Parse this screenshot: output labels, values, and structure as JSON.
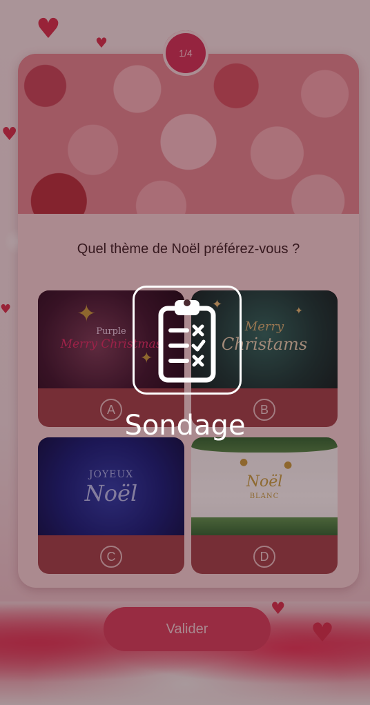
{
  "progress": {
    "label": "1/4",
    "current": 1,
    "total": 4
  },
  "question": "Quel thème de Noël préférez-vous ?",
  "options": [
    {
      "letter": "A",
      "title_top": "Purple",
      "title_main": "Merry Christmas"
    },
    {
      "letter": "B",
      "title_top": "Merry",
      "title_main": "Christams"
    },
    {
      "letter": "C",
      "title_top": "JOYEUX",
      "title_main": "Noël"
    },
    {
      "letter": "D",
      "title_top": "Noël",
      "title_main": "BLANC"
    }
  ],
  "validate_label": "Valider",
  "overlay": {
    "label": "Sondage",
    "icon": "clipboard-checklist-icon"
  },
  "colors": {
    "accent": "#d9415f",
    "card": "#f7d9db",
    "option_footer": "#a2454c"
  }
}
